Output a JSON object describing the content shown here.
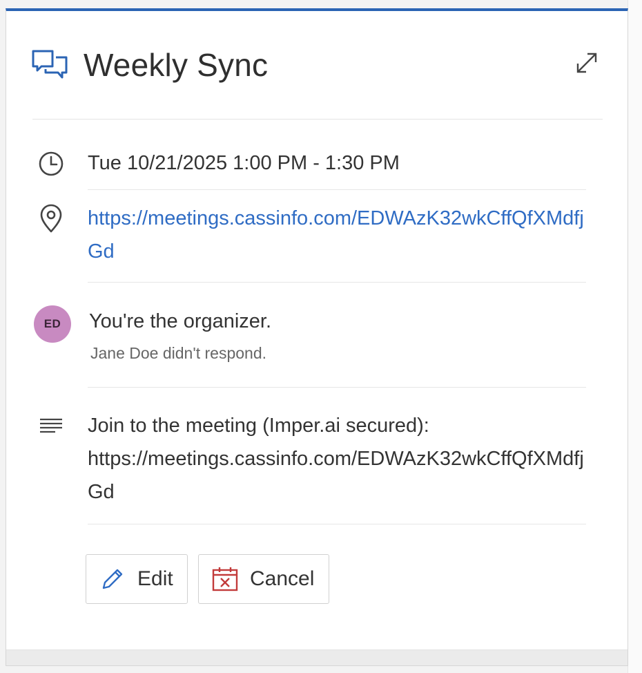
{
  "event": {
    "title": "Weekly Sync",
    "header_icon": "chat-bubbles-icon",
    "expand_icon": "expand-icon"
  },
  "details": {
    "time": "Tue 10/21/2025 1:00 PM - 1:30 PM",
    "location_url": "https://meetings.cassinfo.com/EDWAzK32wkCffQfXMdfjGd",
    "organizer": {
      "initials": "ED",
      "status": "You're the organizer.",
      "attendee_response": "Jane Doe didn't respond."
    },
    "description_line1": "Join to the meeting (Imper.ai secured):",
    "description_url": "https://meetings.cassinfo.com/EDWAzK32wkCffQfXMdfjGd"
  },
  "actions": {
    "edit_label": "Edit",
    "cancel_label": "Cancel"
  },
  "colors": {
    "accent": "#2b64b4",
    "link": "#2f6cc4",
    "avatar": "#c88ac1",
    "cancel_icon": "#c23b3b"
  }
}
